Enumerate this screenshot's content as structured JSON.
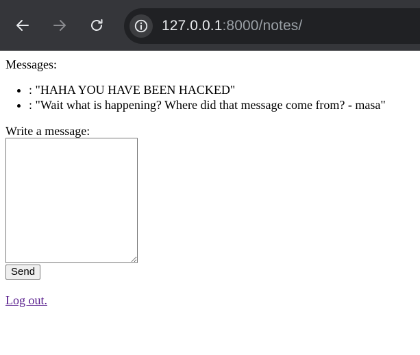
{
  "browser": {
    "url_host": "127.0.0.1",
    "url_path": ":8000/notes/",
    "icons": {
      "back": "arrow-left-icon",
      "forward": "arrow-right-icon",
      "reload": "reload-icon",
      "site_info": "info-icon"
    }
  },
  "page": {
    "messages_heading": "Messages:",
    "messages": [
      ": \"HAHA YOU HAVE BEEN HACKED\"",
      ": \"Wait what is happening? Where did that message come from? - masa\""
    ],
    "compose_label": "Write a message:",
    "message_input_value": "",
    "send_label": "Send",
    "logout_label": "Log out."
  }
}
